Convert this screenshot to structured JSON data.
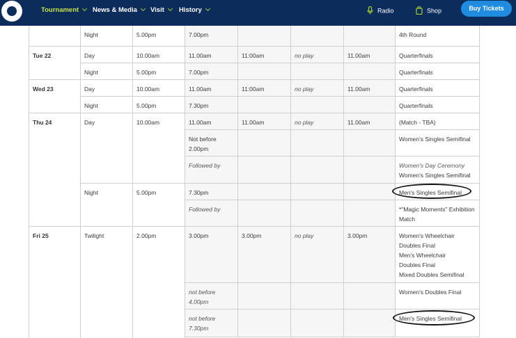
{
  "nav": {
    "items": [
      {
        "label": "Tournament",
        "active": true
      },
      {
        "label": "News & Media",
        "active": false
      },
      {
        "label": "Visit",
        "active": false
      },
      {
        "label": "History",
        "active": false
      }
    ],
    "radio_label": "Radio",
    "shop_label": "Shop",
    "buy_label": "Buy Tickets"
  },
  "colors": {
    "nav_bg": "#0c2c5c",
    "accent": "#a6d12e",
    "button": "#1f8ce0"
  },
  "schedule": {
    "r0": {
      "day": "",
      "session": "Night",
      "gates": "5.00pm",
      "c1": "7.00pm",
      "c2": "",
      "c3": "",
      "c4": "",
      "event": "4th Round"
    },
    "r1": {
      "day": "Tue 22",
      "session": "Day",
      "gates": "10.00am",
      "c1": "11.00am",
      "c2": "11:00am",
      "c3": "no play",
      "c4": "11.00am",
      "event": "Quarterfinals"
    },
    "r2": {
      "day": "",
      "session": "Night",
      "gates": "5.00pm",
      "c1": "7.00pm",
      "c2": "",
      "c3": "",
      "c4": "",
      "event": "Quarterfinals"
    },
    "r3": {
      "day": "Wed 23",
      "session": "Day",
      "gates": "10.00am",
      "c1": "11.00am",
      "c2": "11:00am",
      "c3": "no play",
      "c4": "11.00am",
      "event": "Quarterfinals"
    },
    "r4": {
      "day": "",
      "session": "Night",
      "gates": "5.00pm",
      "c1": "7.30pm",
      "c2": "",
      "c3": "",
      "c4": "",
      "event": "Quarterfinals"
    },
    "r5": {
      "day": "Thu 24",
      "session": "Day",
      "gates": "10.00am",
      "c1": "11.00am",
      "c2": "11.00am",
      "c3": "no play",
      "c4": "11.00am",
      "event": "(Match - TBA)"
    },
    "r6": {
      "c1a": "Not before",
      "c1b": "2.00pm",
      "event": "Women's Singles Semifinal"
    },
    "r7": {
      "c1": "Followed by",
      "event_a": "Women's Day Ceremony",
      "event_b": "Women's Singles Semifinal"
    },
    "r8": {
      "session": "Night",
      "gates": "5.00pm",
      "c1": "7.30pm",
      "event": "Men's Singles Semifinal"
    },
    "r9": {
      "c1": "Followed by",
      "event_a": "*\"Magic Moments\" Exhibition",
      "event_b": "Match"
    },
    "r10": {
      "day": "Fri 25",
      "session": "Twilight",
      "gates": "2.00pm",
      "c1": "3.00pm",
      "c2": "3.00pm",
      "c3": "no play",
      "c4": "3.00pm",
      "event_lines": [
        "Women's Wheelchair",
        "Doubles Final",
        "Men's Wheelchair",
        "Doubles Final",
        "Mixed Doubles Semifinal"
      ]
    },
    "r11": {
      "c1a": "not before",
      "c1b": "4.00pm",
      "event": "Women's Doubles Final"
    },
    "r12": {
      "c1a": "not before",
      "c1b": "7.30pm",
      "event": "Men's Singles Semifinal"
    }
  }
}
